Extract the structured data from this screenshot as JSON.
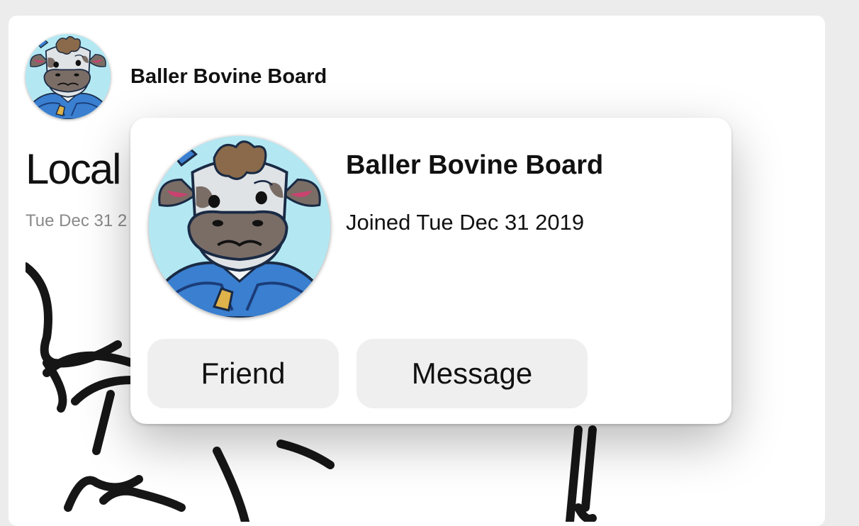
{
  "post": {
    "author": "Baller Bovine Board",
    "title": "Local",
    "date": "Tue Dec 31 2"
  },
  "popover": {
    "name": "Baller Bovine Board",
    "joined": "Joined Tue Dec 31 2019",
    "friend_label": "Friend",
    "message_label": "Message"
  },
  "colors": {
    "page_bg": "#ececec",
    "button_bg": "#efefef",
    "avatar_bg": "#b3e8f3",
    "avatar_jacket": "#3a7fd0"
  },
  "icons": {
    "author_avatar": "cow-avatar",
    "post_image": "cow-sketch-drawing"
  }
}
